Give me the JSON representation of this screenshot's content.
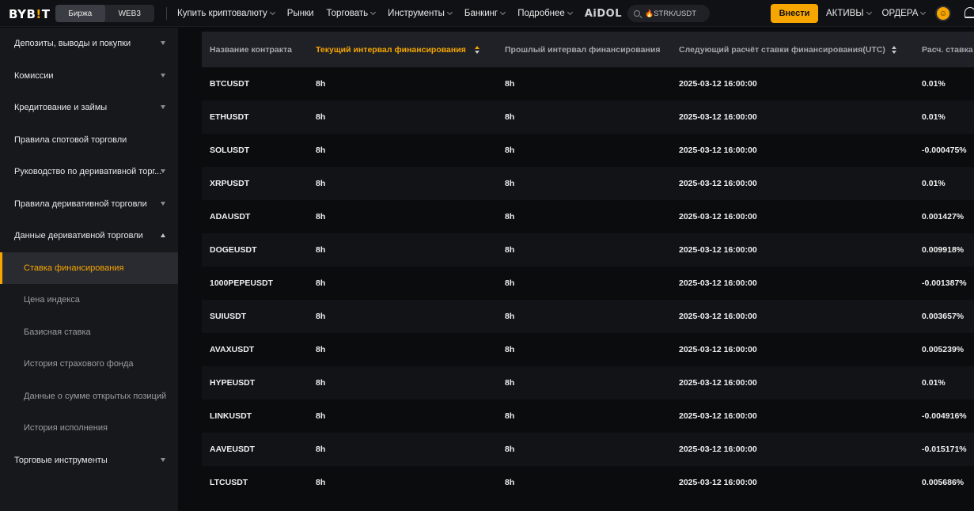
{
  "header": {
    "logo_main": "BYB",
    "logo_accent": "!",
    "logo_end": "T",
    "seg_exchange": "Биржа",
    "seg_web3": "WEB3",
    "nav": [
      "Купить криптовалюту",
      "Рынки",
      "Торговать",
      "Инструменты",
      "Банкинг",
      "Подробнее"
    ],
    "aidol": "AiDOL",
    "search_value": "STRK/USDT",
    "deposit": "Внести",
    "assets": "АКТИВЫ",
    "orders": "ОРДЕРА"
  },
  "sidebar": {
    "items": [
      {
        "label": "Депозиты, выводы и покупки"
      },
      {
        "label": "Комиссии"
      },
      {
        "label": "Кредитование и займы"
      },
      {
        "label": "Правила спотовой торговли"
      },
      {
        "label": "Руководство по деривативной торг..."
      },
      {
        "label": "Правила деривативной торговли"
      },
      {
        "label": "Данные деривативной торговли"
      },
      {
        "label": "Ставка финансирования"
      },
      {
        "label": "Цена индекса"
      },
      {
        "label": "Базисная ставка"
      },
      {
        "label": "История страхового фонда"
      },
      {
        "label": "Данные о сумме открытых позиций"
      },
      {
        "label": "История исполнения"
      },
      {
        "label": "Торговые инструменты"
      }
    ]
  },
  "table": {
    "headers": {
      "contract": "Название контракта",
      "current_interval": "Текущий интервал финансирования",
      "prev_interval": "Прошлый интервал финансирования",
      "next_calc": "Следующий расчёт ставки финансирования(UTC)",
      "rate": "Расч. ставка"
    },
    "rows": [
      {
        "contract": "BTCUSDT",
        "cur": "8h",
        "prev": "8h",
        "next": "2025-03-12 16:00:00",
        "rate": "0.01%"
      },
      {
        "contract": "ETHUSDT",
        "cur": "8h",
        "prev": "8h",
        "next": "2025-03-12 16:00:00",
        "rate": "0.01%"
      },
      {
        "contract": "SOLUSDT",
        "cur": "8h",
        "prev": "8h",
        "next": "2025-03-12 16:00:00",
        "rate": "-0.000475%"
      },
      {
        "contract": "XRPUSDT",
        "cur": "8h",
        "prev": "8h",
        "next": "2025-03-12 16:00:00",
        "rate": "0.01%"
      },
      {
        "contract": "ADAUSDT",
        "cur": "8h",
        "prev": "8h",
        "next": "2025-03-12 16:00:00",
        "rate": "0.001427%"
      },
      {
        "contract": "DOGEUSDT",
        "cur": "8h",
        "prev": "8h",
        "next": "2025-03-12 16:00:00",
        "rate": "0.009918%"
      },
      {
        "contract": "1000PEPEUSDT",
        "cur": "8h",
        "prev": "8h",
        "next": "2025-03-12 16:00:00",
        "rate": "-0.001387%"
      },
      {
        "contract": "SUIUSDT",
        "cur": "8h",
        "prev": "8h",
        "next": "2025-03-12 16:00:00",
        "rate": "0.003657%"
      },
      {
        "contract": "AVAXUSDT",
        "cur": "8h",
        "prev": "8h",
        "next": "2025-03-12 16:00:00",
        "rate": "0.005239%"
      },
      {
        "contract": "HYPEUSDT",
        "cur": "8h",
        "prev": "8h",
        "next": "2025-03-12 16:00:00",
        "rate": "0.01%"
      },
      {
        "contract": "LINKUSDT",
        "cur": "8h",
        "prev": "8h",
        "next": "2025-03-12 16:00:00",
        "rate": "-0.004916%"
      },
      {
        "contract": "AAVEUSDT",
        "cur": "8h",
        "prev": "8h",
        "next": "2025-03-12 16:00:00",
        "rate": "-0.015171%"
      },
      {
        "contract": "LTCUSDT",
        "cur": "8h",
        "prev": "8h",
        "next": "2025-03-12 16:00:00",
        "rate": "0.005686%"
      }
    ]
  },
  "colors": {
    "accent": "#f7a600",
    "sidebar_bg": "#17181c",
    "header_bg": "#1f2126"
  }
}
